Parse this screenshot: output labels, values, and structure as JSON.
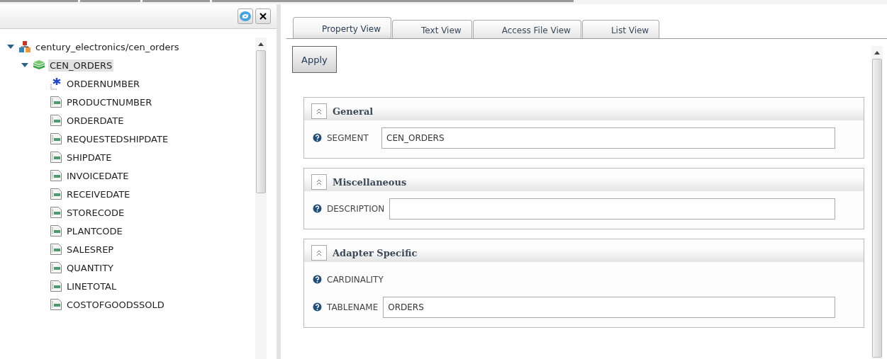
{
  "tree": [
    {
      "label": "century_electronics/cen_orders",
      "kind": "database",
      "expanded": true,
      "selected": false,
      "children": [
        {
          "label": "CEN_ORDERS",
          "kind": "segment",
          "expanded": true,
          "selected": true,
          "children": [
            {
              "label": "ORDERNUMBER",
              "kind": "key",
              "selected": false
            },
            {
              "label": "PRODUCTNUMBER",
              "kind": "field",
              "selected": false
            },
            {
              "label": "ORDERDATE",
              "kind": "field",
              "selected": false
            },
            {
              "label": "REQUESTEDSHIPDATE",
              "kind": "field",
              "selected": false
            },
            {
              "label": "SHIPDATE",
              "kind": "field",
              "selected": false
            },
            {
              "label": "INVOICEDATE",
              "kind": "field",
              "selected": false
            },
            {
              "label": "RECEIVEDATE",
              "kind": "field",
              "selected": false
            },
            {
              "label": "STORECODE",
              "kind": "field",
              "selected": false
            },
            {
              "label": "PLANTCODE",
              "kind": "field",
              "selected": false
            },
            {
              "label": "SALESREP",
              "kind": "field",
              "selected": false
            },
            {
              "label": "QUANTITY",
              "kind": "field",
              "selected": false
            },
            {
              "label": "LINETOTAL",
              "kind": "field",
              "selected": false
            },
            {
              "label": "COSTOFGOODSSOLD",
              "kind": "field",
              "selected": false
            }
          ]
        }
      ]
    }
  ],
  "tabs": [
    {
      "label": "Property View",
      "selected": true
    },
    {
      "label": "Text View",
      "selected": false
    },
    {
      "label": "Access File View",
      "selected": false
    },
    {
      "label": "List View",
      "selected": false
    }
  ],
  "apply_button": "Apply",
  "sections": [
    {
      "title": "General",
      "expanded": true,
      "fields": [
        {
          "label": "SEGMENT",
          "kind": "input",
          "value": "CEN_ORDERS"
        }
      ]
    },
    {
      "title": "Miscellaneous",
      "expanded": true,
      "fields": [
        {
          "label": "DESCRIPTION",
          "kind": "input"
        }
      ]
    },
    {
      "title": "Adapter Specific",
      "expanded": true,
      "fields": [
        {
          "label": "CARDINALITY",
          "kind": "label"
        },
        {
          "label": "TABLENAME",
          "kind": "input",
          "value": "ORDERS"
        }
      ]
    }
  ]
}
